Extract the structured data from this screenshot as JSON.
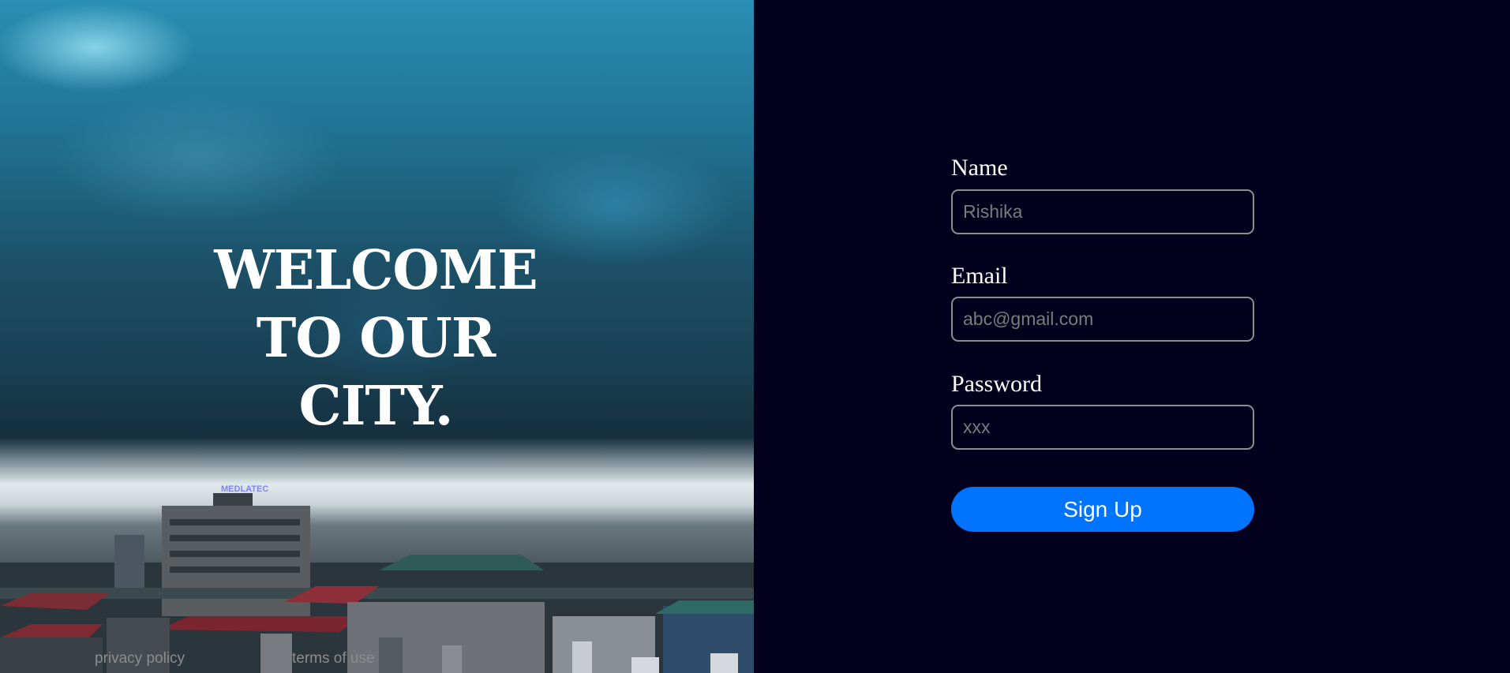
{
  "hero": {
    "title_line1": "WELCOME",
    "title_line2": "TO OUR",
    "title_line3": "CITY.",
    "sign_text": "MEDLATEC"
  },
  "footer": {
    "privacy_label": "privacy policy",
    "terms_label": "terms of use"
  },
  "form": {
    "name_label": "Name",
    "name_placeholder": "Rishika",
    "email_label": "Email",
    "email_placeholder": "abc@gmail.com",
    "password_label": "Password",
    "password_placeholder": "xxx",
    "signup_label": "Sign Up"
  },
  "colors": {
    "background": "#02001d",
    "button": "#0174ff",
    "input_border": "#8e8e8e",
    "text": "#ffffff",
    "footer_text": "#8c8c8c"
  }
}
